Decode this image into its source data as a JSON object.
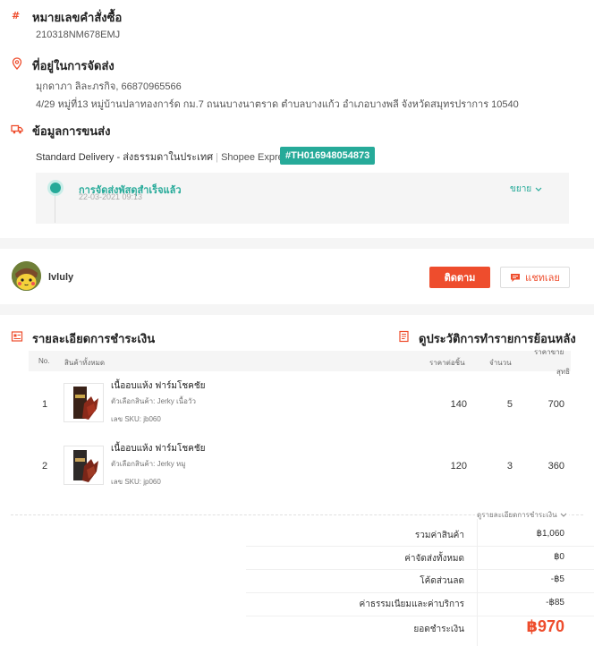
{
  "order": {
    "number_title": "หมายเลขคำสั่งซื้อ",
    "number": "210318NM678EMJ",
    "address_title": "ที่อยู่ในการจัดส่ง",
    "recipient": "มุกดาภา ลิละภรกิจ, 66870965566",
    "address": "4/29 หมู่ที่13 หมู่บ้านปลาทองการ์ด กม.7 ถนนบางนาตราด ตำบลบางแก้ว อำเภอบางพลี จังหวัดสมุทรปราการ 10540",
    "shipping_title": "ข้อมูลการขนส่ง",
    "shipping_method": "Standard Delivery - ส่งธรรมดาในประเทศ",
    "separator": "|",
    "carrier": "Shopee Express",
    "tracking": "#TH016948054873",
    "status": "การจัดส่งพัสดุสำเร็จแล้ว",
    "status_time": "22-03-2021 09:13",
    "expand_label": "ขยาย"
  },
  "seller": {
    "name": "lvluly",
    "follow_label": "ติดตาม",
    "chat_label": "แชทเลย"
  },
  "payment": {
    "title": "รายละเอียดการชำระเงิน",
    "history_title": "ดูประวัติการทำรายการย้อนหลัง",
    "headers": {
      "no": "No.",
      "products": "สินค้าทั้งหมด",
      "unit_price": "ราคาต่อชิ้น",
      "qty": "จำนวน",
      "net_line1": "ราคาขาย",
      "net_line2": "สุทธิ"
    },
    "items": [
      {
        "no": "1",
        "name": "เนื้ออบแห้ง ฟาร์มโชคชัย",
        "variation": "ตัวเลือกสินค้า: Jerky เนื้อวัว",
        "sku": "เลข SKU:  jb060",
        "price": "140",
        "qty": "5",
        "total": "700"
      },
      {
        "no": "2",
        "name": "เนื้ออบแห้ง ฟาร์มโชคชัย",
        "variation": "ตัวเลือกสินค้า: Jerky หมู",
        "sku": "เลข SKU:  jp060",
        "price": "120",
        "qty": "3",
        "total": "360"
      }
    ],
    "details_toggle": "ดูรายละเอียดการชำระเงิน",
    "summary": {
      "subtotal_label": "รวมค่าสินค้า",
      "subtotal": "฿1,060",
      "shipping_label": "ค่าจัดส่งทั้งหมด",
      "shipping": "฿0",
      "discount_label": "โค้ดส่วนลด",
      "discount": "-฿5",
      "fee_label": "ค่าธรรมเนียมและค่าบริการ",
      "fee": "-฿85",
      "total_label": "ยอดชำระเงิน",
      "total": "฿970"
    }
  },
  "colors": {
    "brand": "#ee4d2d",
    "teal": "#26aa99"
  }
}
